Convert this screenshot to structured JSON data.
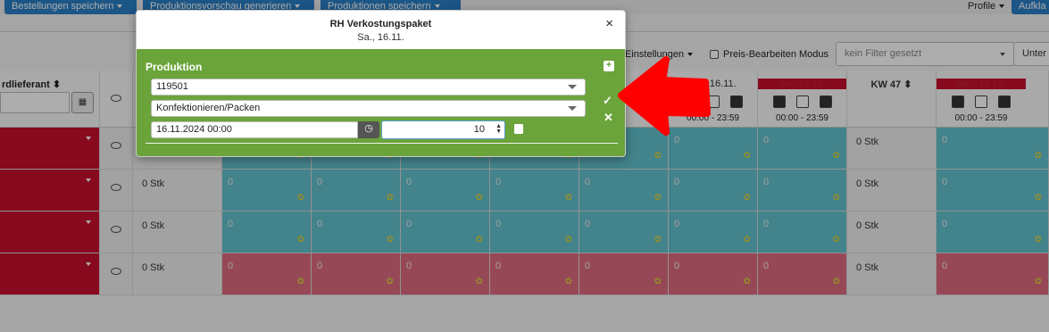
{
  "toolbar": {
    "save_orders": "Bestellungen speichern",
    "generate_preview": "Produktionsvorschau generieren",
    "save_productions": "Produktionen speichern",
    "aufkl": "Aufkla",
    "profile": "Profile"
  },
  "filters": {
    "settings": "Einstellungen",
    "price_edit_mode": "Preis-Bearbeiten Modus",
    "filter_placeholder": "kein Filter gesetzt",
    "unter": "Unter"
  },
  "grid": {
    "supplier_header": "rdlieferant",
    "days": [
      {
        "label": "Sa., 16.11.",
        "time": "00:00 - 23:59",
        "weekend": false
      },
      {
        "label": "So., 17.11.",
        "time": "00:00 - 23:59",
        "weekend": true
      },
      {
        "label": "KW 47",
        "time": "",
        "weekend": false
      },
      {
        "label": "Mo., 18.11.",
        "time": "00:00 - 23:59",
        "weekend": true
      }
    ],
    "stk_label": "0 Stk",
    "zero": "0"
  },
  "modal": {
    "title": "RH Verkostungspaket",
    "subtitle": "Sa., 16.11.",
    "section_title": "Produktion",
    "article_value": "119501",
    "process_value": "Konfektionieren/Packen",
    "datetime_value": "16.11.2024 00:00",
    "quantity_value": "10",
    "close_glyph": "×",
    "plus_glyph": "+",
    "confirm_glyph": "✓",
    "cancel_glyph": "✕"
  },
  "colors": {
    "primary": "#2a7fc6",
    "modal_green": "#6ba43a",
    "teal_cell": "#64c2cd",
    "pink_cell": "#df6b7f",
    "red_cell": "#c8102e",
    "arrow": "#ff0000"
  }
}
